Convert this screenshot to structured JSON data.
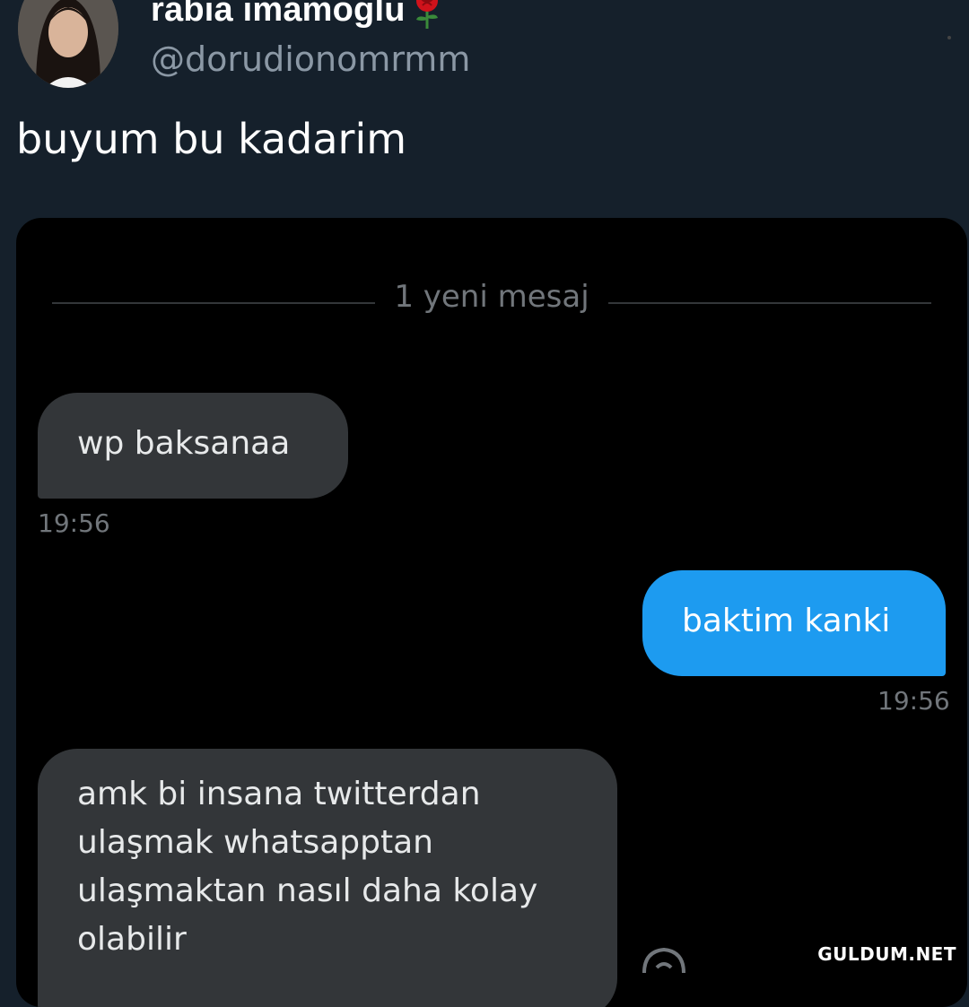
{
  "tweet": {
    "display_name": "rabia imamoglu",
    "name_emoji": "rose-icon",
    "handle": "@dorudionomrmm",
    "text": "buyum bu kadarim"
  },
  "dm": {
    "divider_label": "1 yeni mesaj",
    "messages": [
      {
        "direction": "incoming",
        "lines": [
          "wp baksanaa"
        ],
        "time": "19:56"
      },
      {
        "direction": "outgoing",
        "lines": [
          "baktim kanki"
        ],
        "time": "19:56"
      },
      {
        "direction": "incoming",
        "lines": [
          "amk bi insana twitterdan",
          "ulaşmak whatsapptan",
          "ulaşmaktan nasıl daha kolay",
          "olabilir"
        ]
      }
    ]
  },
  "watermark": "GULDUM.NET",
  "colors": {
    "background": "#15202b",
    "media_background": "#000000",
    "incoming_bubble": "#333639",
    "outgoing_bubble": "#1d9bf0",
    "secondary_text": "#71767b",
    "handle_text": "#8b98a5"
  }
}
